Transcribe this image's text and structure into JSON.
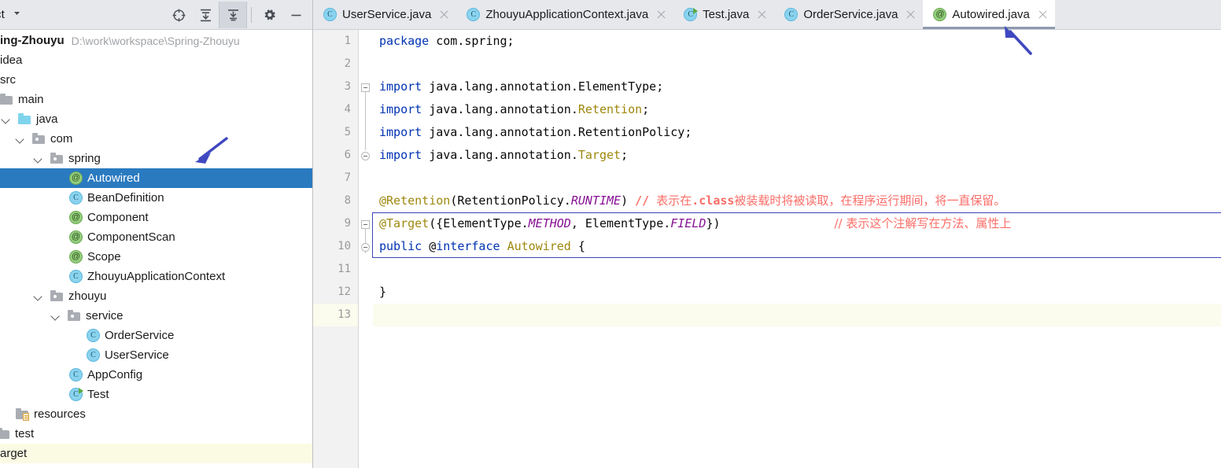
{
  "window": {
    "app": "IntelliJ IDEA"
  },
  "project_pane": {
    "title": "ct",
    "caret_icon": "chevron-down-icon",
    "toolbar": [
      {
        "name": "locate-icon",
        "label": "Select Opened File"
      },
      {
        "name": "expand-all-icon",
        "label": "Expand All"
      },
      {
        "name": "collapse-all-icon",
        "label": "Collapse All"
      },
      {
        "name": "gear-icon",
        "label": "Settings"
      },
      {
        "name": "minimize-icon",
        "label": "Hide"
      }
    ],
    "tree": [
      {
        "label": "ing-Zhouyu",
        "path": "D:\\work\\workspace\\Spring-Zhouyu",
        "icon": "project-icon",
        "indent": 0,
        "bold": true,
        "twisty": "",
        "selected": false,
        "excluded": false
      },
      {
        "label": "idea",
        "path": "",
        "icon": "folder-icon",
        "indent": 0,
        "bold": false,
        "twisty": "",
        "selected": false,
        "excluded": false
      },
      {
        "label": "src",
        "path": "",
        "icon": "folder-icon",
        "indent": 0,
        "bold": false,
        "twisty": "",
        "selected": false,
        "excluded": false
      },
      {
        "label": "main",
        "path": "",
        "icon": "folder-icon",
        "indent": 1,
        "bold": false,
        "twisty": "",
        "selected": false,
        "excluded": false
      },
      {
        "label": "java",
        "path": "",
        "icon": "source-folder-icon",
        "indent": 1,
        "bold": false,
        "twisty": "open",
        "selected": false,
        "excluded": false
      },
      {
        "label": "com",
        "path": "",
        "icon": "package-icon",
        "indent": 2,
        "bold": false,
        "twisty": "open",
        "selected": false,
        "excluded": false
      },
      {
        "label": "spring",
        "path": "",
        "icon": "package-icon",
        "indent": 3,
        "bold": false,
        "twisty": "open",
        "selected": false,
        "excluded": false
      },
      {
        "label": "Autowired",
        "path": "",
        "icon": "annotation-icon",
        "indent": 5,
        "bold": false,
        "twisty": "",
        "selected": true,
        "excluded": false
      },
      {
        "label": "BeanDefinition",
        "path": "",
        "icon": "class-icon",
        "indent": 5,
        "bold": false,
        "twisty": "",
        "selected": false,
        "excluded": false
      },
      {
        "label": "Component",
        "path": "",
        "icon": "annotation-icon",
        "indent": 5,
        "bold": false,
        "twisty": "",
        "selected": false,
        "excluded": false
      },
      {
        "label": "ComponentScan",
        "path": "",
        "icon": "annotation-icon",
        "indent": 5,
        "bold": false,
        "twisty": "",
        "selected": false,
        "excluded": false
      },
      {
        "label": "Scope",
        "path": "",
        "icon": "annotation-icon",
        "indent": 5,
        "bold": false,
        "twisty": "",
        "selected": false,
        "excluded": false
      },
      {
        "label": "ZhouyuApplicationContext",
        "path": "",
        "icon": "class-icon",
        "indent": 5,
        "bold": false,
        "twisty": "",
        "selected": false,
        "excluded": false
      },
      {
        "label": "zhouyu",
        "path": "",
        "icon": "package-icon",
        "indent": 3,
        "bold": false,
        "twisty": "open",
        "selected": false,
        "excluded": false
      },
      {
        "label": "service",
        "path": "",
        "icon": "package-icon",
        "indent": 4,
        "bold": false,
        "twisty": "open",
        "selected": false,
        "excluded": false
      },
      {
        "label": "OrderService",
        "path": "",
        "icon": "class-icon",
        "indent": 6,
        "bold": false,
        "twisty": "",
        "selected": false,
        "excluded": false
      },
      {
        "label": "UserService",
        "path": "",
        "icon": "class-icon",
        "indent": 6,
        "bold": false,
        "twisty": "",
        "selected": false,
        "excluded": false
      },
      {
        "label": "AppConfig",
        "path": "",
        "icon": "class-icon",
        "indent": 5,
        "bold": false,
        "twisty": "",
        "selected": false,
        "excluded": false
      },
      {
        "label": "Test",
        "path": "",
        "icon": "runnable-class-icon",
        "indent": 5,
        "bold": false,
        "twisty": "",
        "selected": false,
        "excluded": false
      },
      {
        "label": "resources",
        "path": "",
        "icon": "resource-folder-icon",
        "indent": 1,
        "bold": false,
        "twisty": "",
        "selected": false,
        "excluded": false
      },
      {
        "label": "test",
        "path": "",
        "icon": "folder-icon",
        "indent": 0,
        "bold": false,
        "twisty": "",
        "selected": false,
        "excluded": false
      },
      {
        "label": "arget",
        "path": "",
        "icon": "folder-icon",
        "indent": 0,
        "bold": false,
        "twisty": "",
        "selected": false,
        "excluded": true
      }
    ]
  },
  "editor": {
    "tabs": [
      {
        "label": "UserService.java",
        "icon": "class-icon",
        "active": false,
        "close_icon": "close-icon"
      },
      {
        "label": "ZhouyuApplicationContext.java",
        "icon": "class-icon",
        "active": false,
        "close_icon": "close-icon"
      },
      {
        "label": "Test.java",
        "icon": "runnable-class-icon",
        "active": false,
        "close_icon": "close-icon"
      },
      {
        "label": "OrderService.java",
        "icon": "class-icon",
        "active": false,
        "close_icon": "close-icon"
      },
      {
        "label": "Autowired.java",
        "icon": "annotation-icon",
        "active": true,
        "close_icon": "close-icon"
      }
    ],
    "line_numbers": [
      "1",
      "2",
      "3",
      "4",
      "5",
      "6",
      "7",
      "8",
      "9",
      "10",
      "11",
      "12",
      "13"
    ],
    "current_line": "13",
    "lines": [
      {
        "n": "1",
        "tokens": [
          {
            "t": "package ",
            "c": "kw"
          },
          {
            "t": "com.spring;",
            "c": "plain"
          }
        ]
      },
      {
        "n": "2",
        "tokens": []
      },
      {
        "n": "3",
        "tokens": [
          {
            "t": "import ",
            "c": "kw"
          },
          {
            "t": "java.lang.annotation.ElementType;",
            "c": "plain"
          }
        ]
      },
      {
        "n": "4",
        "tokens": [
          {
            "t": "import ",
            "c": "kw"
          },
          {
            "t": "java.lang.annotation.",
            "c": "plain"
          },
          {
            "t": "Retention",
            "c": "anno"
          },
          {
            "t": ";",
            "c": "plain"
          }
        ]
      },
      {
        "n": "5",
        "tokens": [
          {
            "t": "import ",
            "c": "kw"
          },
          {
            "t": "java.lang.annotation.RetentionPolicy;",
            "c": "plain"
          }
        ]
      },
      {
        "n": "6",
        "tokens": [
          {
            "t": "import ",
            "c": "kw"
          },
          {
            "t": "java.lang.annotation.",
            "c": "plain"
          },
          {
            "t": "Target",
            "c": "anno"
          },
          {
            "t": ";",
            "c": "plain"
          }
        ]
      },
      {
        "n": "7",
        "tokens": []
      },
      {
        "n": "8",
        "tokens": [
          {
            "t": "@Retention",
            "c": "anno"
          },
          {
            "t": "(RetentionPolicy.",
            "c": "plain"
          },
          {
            "t": "RUNTIME",
            "c": "const"
          },
          {
            "t": ") ",
            "c": "plain"
          },
          {
            "t": "// ",
            "c": "cmt-b"
          },
          {
            "t": "表示在",
            "c": "cmt cn"
          },
          {
            "t": ".class",
            "c": "cmt-b"
          },
          {
            "t": "被装载时将被读取，在程序运行期间，将一直保留。",
            "c": "cmt cn"
          }
        ]
      },
      {
        "n": "9",
        "tokens": [
          {
            "t": "@Target",
            "c": "anno"
          },
          {
            "t": "({ElementType.",
            "c": "plain"
          },
          {
            "t": "METHOD",
            "c": "const"
          },
          {
            "t": ", ElementType.",
            "c": "plain"
          },
          {
            "t": "FIELD",
            "c": "const"
          },
          {
            "t": "})",
            "c": "plain"
          }
        ]
      },
      {
        "n": "10",
        "tokens": [
          {
            "t": "public ",
            "c": "kw"
          },
          {
            "t": "@",
            "c": "plain"
          },
          {
            "t": "interface ",
            "c": "kw"
          },
          {
            "t": "Autowired",
            "c": "anno"
          },
          {
            "t": " {",
            "c": "plain"
          }
        ]
      },
      {
        "n": "11",
        "tokens": []
      },
      {
        "n": "12",
        "tokens": [
          {
            "t": "}",
            "c": "plain"
          }
        ]
      },
      {
        "n": "13",
        "tokens": []
      }
    ],
    "line9_trailing_comment": "// 表示这个注解写在方法、属性上",
    "highlight_box_label": "annotation-lines-highlight"
  },
  "annotations": {
    "arrow_tree": {
      "name": "arrow-pointing-to-spring-package",
      "color": "#3f48c0"
    },
    "arrow_tab": {
      "name": "arrow-pointing-to-autowired-tab",
      "color": "#3f48c0"
    }
  },
  "colors": {
    "selection_blue": "#2a7ac0",
    "annotation_olive": "#9e880d",
    "constant_purple": "#871094",
    "comment_red": "#fa6e68",
    "keyword_blue": "#0033b3",
    "excluded_yellow": "#fbfbe4",
    "arrow_indigo": "#3f48c0",
    "highlight_border": "#3b44b8"
  }
}
